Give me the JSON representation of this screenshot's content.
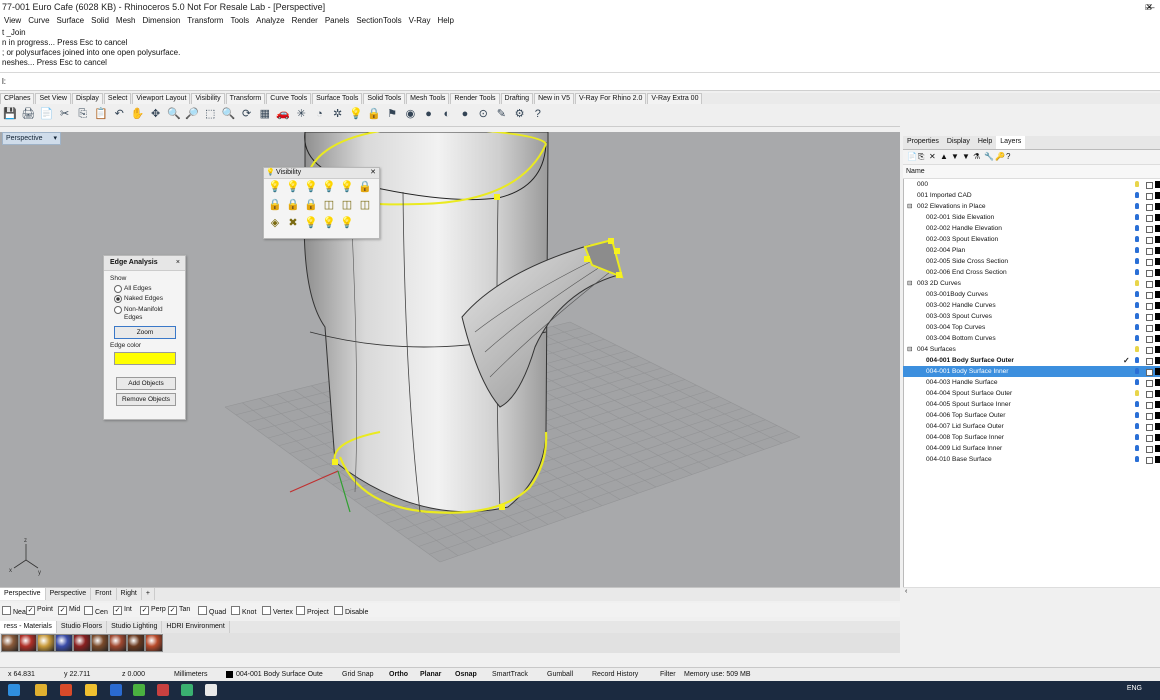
{
  "window": {
    "title": "77-001 Euro Cafe (6028 KB) - Rhinoceros 5.0 Not For Resale Lab - [Perspective]"
  },
  "menu": [
    "View",
    "Curve",
    "Surface",
    "Solid",
    "Mesh",
    "Dimension",
    "Transform",
    "Tools",
    "Analyze",
    "Render",
    "Panels",
    "SectionTools",
    "V-Ray",
    "Help"
  ],
  "command_history": [
    "t _Join",
    "n in progress... Press Esc to cancel",
    "; or polysurfaces joined into one open polysurface.",
    "neshes... Press Esc to cancel"
  ],
  "command_prompt": "l:",
  "toolbar_tabs": [
    "CPlanes",
    "Set View",
    "Display",
    "Select",
    "Viewport Layout",
    "Visibility",
    "Transform",
    "Curve Tools",
    "Surface Tools",
    "Solid Tools",
    "Mesh Tools",
    "Render Tools",
    "Drafting",
    "New in V5",
    "V-Ray For Rhino 2.0",
    "V-Ray Extra 00"
  ],
  "viewport": {
    "label": "Perspective"
  },
  "visibility_panel": {
    "title": "Visibility"
  },
  "edge_analysis": {
    "title": "Edge Analysis",
    "show_label": "Show",
    "options": [
      "All Edges",
      "Naked Edges",
      "Non-Manifold Edges"
    ],
    "selected": "Naked Edges",
    "zoom_button": "Zoom",
    "edge_color_label": "Edge color",
    "edge_color": "#ffff00",
    "add_objects_button": "Add Objects",
    "remove_objects_button": "Remove Objects"
  },
  "right_panel": {
    "tabs": [
      "Properties",
      "Display",
      "Help",
      "Layers"
    ],
    "active_tab": "Layers",
    "column_header": "Name",
    "layers": [
      {
        "name": "000",
        "indent": 1,
        "on": false,
        "current": false,
        "selected": false
      },
      {
        "name": "001 Imported CAD",
        "indent": 1,
        "on": true,
        "current": false,
        "selected": false
      },
      {
        "name": "002 Elevations in Place",
        "indent": 0,
        "on": true,
        "current": false,
        "selected": false,
        "expander": "⊟"
      },
      {
        "name": "002-001 Side Elevation",
        "indent": 2,
        "on": true,
        "current": false,
        "selected": false
      },
      {
        "name": "002-002 Handle Elevation",
        "indent": 2,
        "on": true,
        "current": false,
        "selected": false
      },
      {
        "name": "002-003 Spout Elevation",
        "indent": 2,
        "on": true,
        "current": false,
        "selected": false
      },
      {
        "name": "002-004 Plan",
        "indent": 2,
        "on": true,
        "current": false,
        "selected": false
      },
      {
        "name": "002-005 Side Cross Section",
        "indent": 2,
        "on": true,
        "current": false,
        "selected": false
      },
      {
        "name": "002-006  End Cross Section",
        "indent": 2,
        "on": true,
        "current": false,
        "selected": false
      },
      {
        "name": "003 2D Curves",
        "indent": 0,
        "on": false,
        "current": false,
        "selected": false,
        "expander": "⊟"
      },
      {
        "name": "003-001Body Curves",
        "indent": 2,
        "on": true,
        "current": false,
        "selected": false
      },
      {
        "name": "003-002 Handle Curves",
        "indent": 2,
        "on": true,
        "current": false,
        "selected": false
      },
      {
        "name": "003-003 Spout Curves",
        "indent": 2,
        "on": true,
        "current": false,
        "selected": false
      },
      {
        "name": "003-004 Top Curves",
        "indent": 2,
        "on": true,
        "current": false,
        "selected": false
      },
      {
        "name": "003-004 Bottom Curves",
        "indent": 2,
        "on": true,
        "current": false,
        "selected": false
      },
      {
        "name": "004 Surfaces",
        "indent": 0,
        "on": false,
        "current": false,
        "selected": false,
        "expander": "⊟"
      },
      {
        "name": "004-001 Body Surface Outer",
        "indent": 2,
        "on": true,
        "current": true,
        "selected": false
      },
      {
        "name": "004-001 Body Surface Inner",
        "indent": 2,
        "on": true,
        "current": false,
        "selected": true
      },
      {
        "name": "004-003 Handle Surface",
        "indent": 2,
        "on": true,
        "current": false,
        "selected": false
      },
      {
        "name": "004-004 Spout Surface Outer",
        "indent": 2,
        "on": false,
        "current": false,
        "selected": false
      },
      {
        "name": "004-005 Spout Surface Inner",
        "indent": 2,
        "on": true,
        "current": false,
        "selected": false
      },
      {
        "name": "004-006 Top Surface Outer",
        "indent": 2,
        "on": true,
        "current": false,
        "selected": false
      },
      {
        "name": "004-007 Lid Surface Outer",
        "indent": 2,
        "on": true,
        "current": false,
        "selected": false
      },
      {
        "name": "004-008 Top Surface Inner",
        "indent": 2,
        "on": true,
        "current": false,
        "selected": false
      },
      {
        "name": "004-009 Lid Surface Inner",
        "indent": 2,
        "on": true,
        "current": false,
        "selected": false
      },
      {
        "name": "004-010 Base Surface",
        "indent": 2,
        "on": true,
        "current": false,
        "selected": false
      }
    ]
  },
  "viewport_tabs": [
    "Perspective",
    "Perspective",
    "Front",
    "Right",
    "+"
  ],
  "osnaps": [
    {
      "label": "Near",
      "checked": false
    },
    {
      "label": "Point",
      "checked": true
    },
    {
      "label": "Mid",
      "checked": true
    },
    {
      "label": "Cen",
      "checked": false
    },
    {
      "label": "Int",
      "checked": true
    },
    {
      "label": "Perp",
      "checked": true
    },
    {
      "label": "Tan",
      "checked": true
    },
    {
      "label": "Quad",
      "checked": false
    },
    {
      "label": "Knot",
      "checked": false
    },
    {
      "label": "Vertex",
      "checked": false
    },
    {
      "label": "Project",
      "checked": false
    },
    {
      "label": "Disable",
      "checked": false
    }
  ],
  "material_tabs": [
    "ress - Materials",
    "Studio Floors",
    "Studio Lighting",
    "HDRI Environment"
  ],
  "material_swatches": [
    "#8a5a3a",
    "#b03028",
    "#c89a3a",
    "#3a4ca8",
    "#8a2020",
    "#7a4a2a",
    "#a04830",
    "#6a3a20",
    "#b84a2a"
  ],
  "status": {
    "x": "x 64.831",
    "y": "y 22.711",
    "z": "z 0.000",
    "units": "Millimeters",
    "layer": "004-001 Body Surface Oute",
    "toggles": [
      "Grid Snap",
      "Ortho",
      "Planar",
      "Osnap",
      "SmartTrack",
      "Gumball",
      "Record History",
      "Filter"
    ],
    "memory": "Memory use: 509 MB"
  },
  "taskbar": {
    "lang": "ENG"
  }
}
